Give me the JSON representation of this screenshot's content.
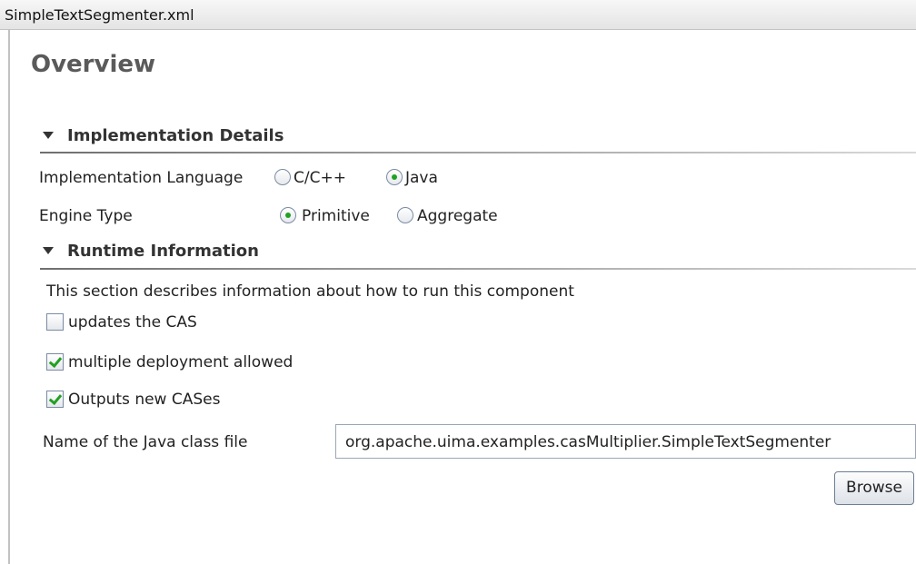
{
  "editor_tab": {
    "file_name": "SimpleTextSegmenter.xml"
  },
  "form": {
    "title": "Overview"
  },
  "implementation_details": {
    "header": "Implementation Details",
    "language_label": "Implementation Language",
    "language_options": [
      {
        "label": "C/C++",
        "selected": false
      },
      {
        "label": "Java",
        "selected": true
      }
    ],
    "engine_label": "Engine Type",
    "engine_options": [
      {
        "label": "Primitive",
        "selected": true
      },
      {
        "label": "Aggregate",
        "selected": false
      }
    ]
  },
  "runtime_information": {
    "header": "Runtime Information",
    "description": "This section describes information about how to run this component",
    "checkboxes": [
      {
        "label": "updates the CAS",
        "checked": false
      },
      {
        "label": "multiple deployment allowed",
        "checked": true
      },
      {
        "label": "Outputs new CASes",
        "checked": true
      }
    ],
    "class_file_label": "Name of the Java class file",
    "class_file_value": "org.apache.uima.examples.casMultiplier.SimpleTextSegmenter",
    "browse_label": "Browse"
  },
  "colors": {
    "check_green": "#23a023",
    "section_text": "#333333",
    "title_gray": "#5a5a5a"
  }
}
